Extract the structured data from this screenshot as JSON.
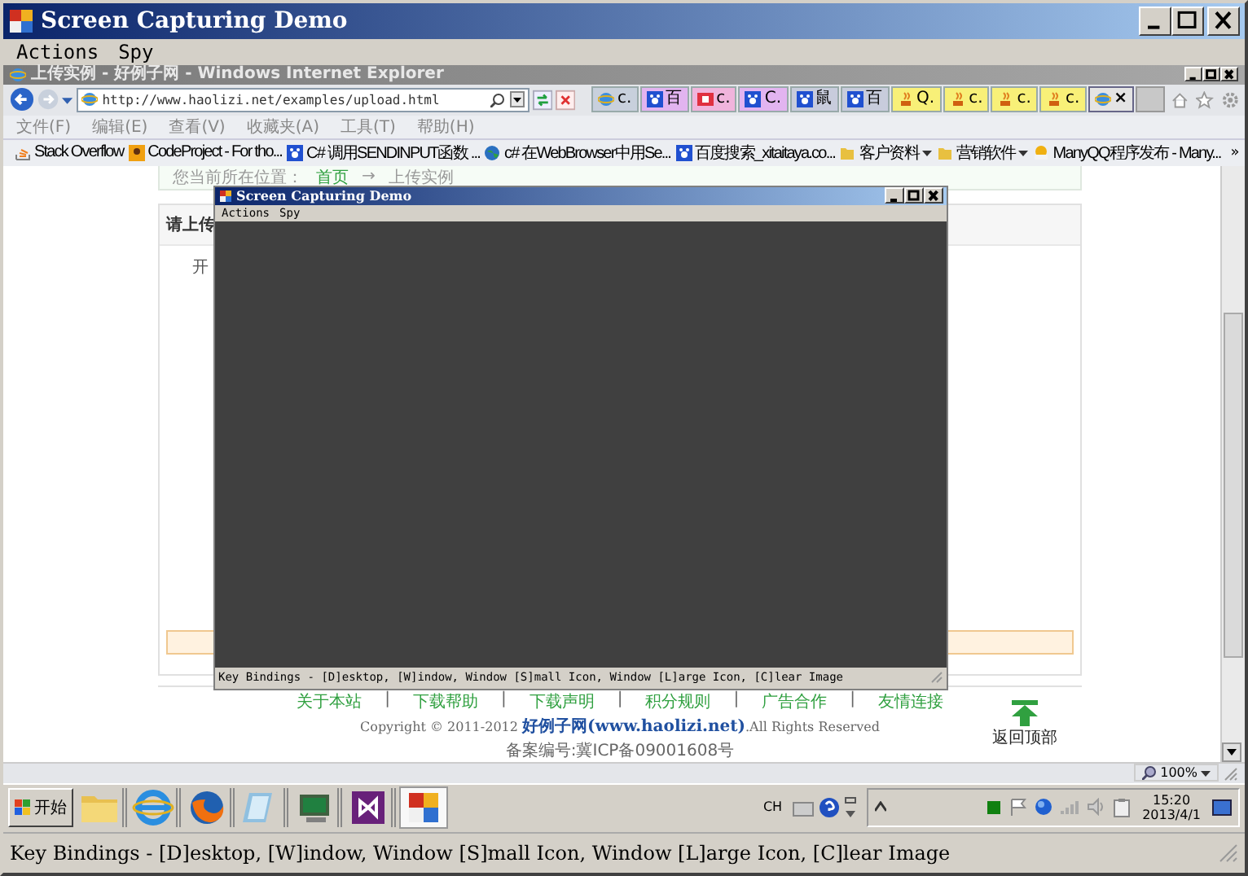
{
  "window": {
    "title": "Screen Capturing Demo"
  },
  "menu": [
    "Actions",
    "Spy"
  ],
  "capture": {
    "browser": {
      "title": "上传实例 - 好例子网 - Windows Internet Explorer",
      "address": "http://www.haolizi.net/examples/upload.html",
      "tabs": [
        {
          "kind": "ie",
          "label": "c.",
          "color": "#c8d0dc",
          "selected": false
        },
        {
          "kind": "paw",
          "label": "百",
          "color": "#e2b4f0",
          "selected": false
        },
        {
          "kind": "b",
          "label": "c.",
          "color": "#f0b4dc",
          "selected": false
        },
        {
          "kind": "paw",
          "label": "C.",
          "color": "#e2b4f0",
          "selected": false
        },
        {
          "kind": "paw",
          "label": "鼠",
          "color": "#c8ccdc",
          "selected": false
        },
        {
          "kind": "paw",
          "label": "百",
          "color": "#c8ccdc",
          "selected": false
        },
        {
          "kind": "cup",
          "label": "Q.",
          "color": "#f8f078",
          "selected": false
        },
        {
          "kind": "cup",
          "label": "c.",
          "color": "#f8f078",
          "selected": false
        },
        {
          "kind": "cup",
          "label": "c.",
          "color": "#f8f078",
          "selected": false
        },
        {
          "kind": "cup",
          "label": "c.",
          "color": "#f8f078",
          "selected": false
        },
        {
          "kind": "ie",
          "label": "×",
          "color": "#e4e4e4",
          "selected": true
        }
      ],
      "menu": [
        "文件(F)",
        "编辑(E)",
        "查看(V)",
        "收藏夹(A)",
        "工具(T)",
        "帮助(H)"
      ],
      "favorites": [
        {
          "kind": "stack",
          "label": "Stack Overflow",
          "dropdown": false
        },
        {
          "kind": "badge",
          "label": "CodeProject - For tho...",
          "dropdown": false
        },
        {
          "kind": "paw",
          "label": "C# 调用SENDINPUT函数 ...",
          "dropdown": false
        },
        {
          "kind": "globe",
          "label": "c# 在WebBrowser中用Se...",
          "dropdown": false
        },
        {
          "kind": "paw",
          "label": "百度搜索_xitaitaya.co...",
          "dropdown": false
        },
        {
          "kind": "folder",
          "label": "客户资料",
          "dropdown": true
        },
        {
          "kind": "folder",
          "label": "营销软件",
          "dropdown": true
        },
        {
          "kind": "sun",
          "label": "ManyQQ程序发布 - Many...",
          "dropdown": false
        }
      ],
      "more": "»",
      "page": {
        "breadcrumb_label": "您当前所在位置：",
        "breadcrumb": [
          {
            "kind": "link",
            "text": "首页"
          },
          {
            "kind": "arrow",
            "text": "→"
          },
          {
            "kind": "plain",
            "text": "上传实例"
          }
        ],
        "panel_title": "请上传",
        "panel_text": "开",
        "footer_links": [
          {
            "kind": "link",
            "text": "关于本站"
          },
          {
            "kind": "sep",
            "text": "|"
          },
          {
            "kind": "link",
            "text": "下载帮助"
          },
          {
            "kind": "sep",
            "text": "|"
          },
          {
            "kind": "link",
            "text": "下载声明"
          },
          {
            "kind": "sep",
            "text": "|"
          },
          {
            "kind": "link",
            "text": "积分规则"
          },
          {
            "kind": "sep",
            "text": "|"
          },
          {
            "kind": "link",
            "text": "广告合作"
          },
          {
            "kind": "sep",
            "text": "|"
          },
          {
            "kind": "link",
            "text": "友情连接"
          }
        ],
        "copyright": "Copyright © 2011-2012 **好例子网(www.haolizi.net)**.All Rights Reserved",
        "icp": "备案编号:冀ICP备09001608号",
        "back_to_top": "返回顶部"
      },
      "zoom": "100%"
    },
    "inner_window": {
      "title": "Screen Capturing Demo",
      "menu": [
        "Actions",
        "Spy"
      ],
      "status": "Key Bindings - [D]esktop, [W]indow, Window [S]mall Icon, Window [L]arge Icon, [C]lear Image"
    },
    "taskbar": {
      "start": "开始",
      "apps": [
        {
          "kind": "folder",
          "selected": false
        },
        {
          "kind": "ie",
          "selected": false
        },
        {
          "kind": "firefox",
          "selected": false
        },
        {
          "kind": "notepad",
          "selected": false
        },
        {
          "kind": "terminal",
          "selected": false
        },
        {
          "kind": "vs",
          "selected": false
        },
        {
          "kind": "app",
          "selected": true
        }
      ],
      "lang": "CH",
      "time": "15:20",
      "date": "2013/4/1"
    }
  },
  "status_bar": "Key Bindings - [D]esktop, [W]indow, Window [S]mall Icon, Window [L]arge Icon, [C]lear Image"
}
